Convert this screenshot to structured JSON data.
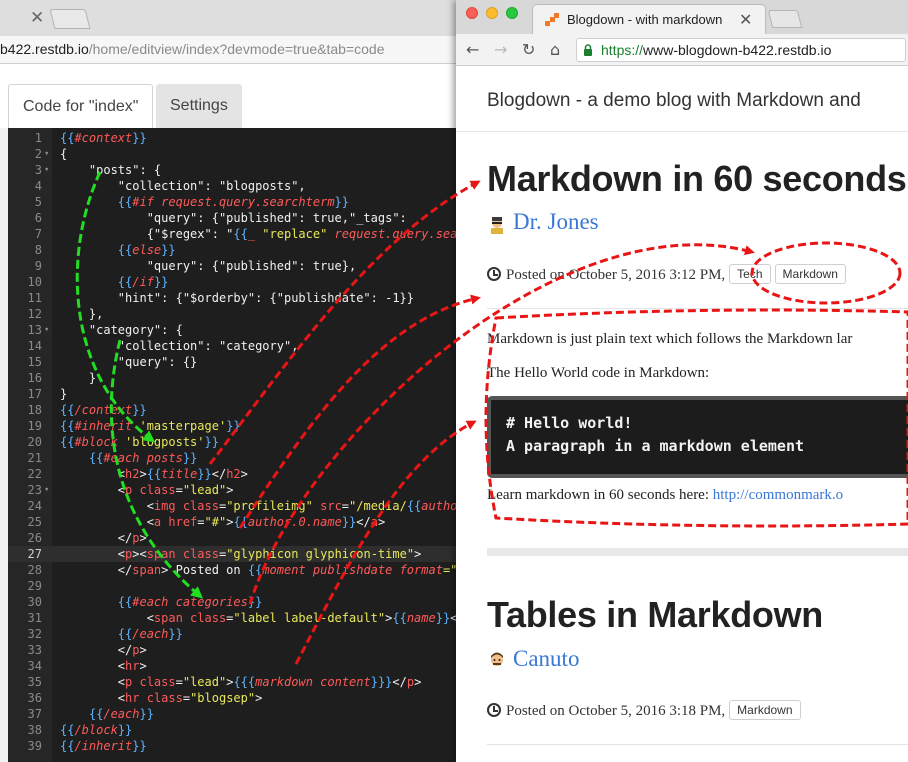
{
  "editor_window": {
    "address_host": "b422.restdb.io",
    "address_path": "/home/editview/index?devmode=true&tab=code",
    "tabs": [
      {
        "label": "Code for \"index\""
      },
      {
        "label": "Settings"
      }
    ],
    "current_line": 27,
    "lines": [
      {
        "n": 1,
        "fold": false,
        "segs": [
          {
            "t": "{{",
            "c": "b"
          },
          {
            "t": "#context",
            "c": "k"
          },
          {
            "t": "}}",
            "c": "b"
          }
        ]
      },
      {
        "n": 2,
        "fold": true,
        "segs": [
          {
            "t": "{",
            "c": "n"
          }
        ]
      },
      {
        "n": 3,
        "fold": true,
        "segs": [
          {
            "t": "    \"posts\": {",
            "c": "n"
          }
        ]
      },
      {
        "n": 4,
        "fold": false,
        "segs": [
          {
            "t": "        \"collection\": \"blogposts\",",
            "c": "n"
          }
        ]
      },
      {
        "n": 5,
        "fold": false,
        "segs": [
          {
            "t": "        ",
            "c": "n"
          },
          {
            "t": "{{",
            "c": "b"
          },
          {
            "t": "#if request.query.searchterm",
            "c": "k"
          },
          {
            "t": "}}",
            "c": "b"
          }
        ]
      },
      {
        "n": 6,
        "fold": false,
        "segs": [
          {
            "t": "            \"query\": {\"published\": true,\"_tags\":",
            "c": "n"
          }
        ]
      },
      {
        "n": 7,
        "fold": false,
        "segs": [
          {
            "t": "            {\"$regex\": \"",
            "c": "n"
          },
          {
            "t": "{{",
            "c": "b"
          },
          {
            "t": "_ ",
            "c": "k"
          },
          {
            "t": "\"replace\"",
            "c": "s"
          },
          {
            "t": " request.query.sea",
            "c": "k"
          }
        ]
      },
      {
        "n": 8,
        "fold": false,
        "segs": [
          {
            "t": "        ",
            "c": "n"
          },
          {
            "t": "{{",
            "c": "b"
          },
          {
            "t": "else",
            "c": "k"
          },
          {
            "t": "}}",
            "c": "b"
          }
        ]
      },
      {
        "n": 9,
        "fold": false,
        "segs": [
          {
            "t": "            \"query\": {\"published\": true},",
            "c": "n"
          }
        ]
      },
      {
        "n": 10,
        "fold": false,
        "segs": [
          {
            "t": "        ",
            "c": "n"
          },
          {
            "t": "{{",
            "c": "b"
          },
          {
            "t": "/if",
            "c": "k"
          },
          {
            "t": "}}",
            "c": "b"
          }
        ]
      },
      {
        "n": 11,
        "fold": false,
        "segs": [
          {
            "t": "        \"hint\": {\"$orderby\": {\"publishdate\": -1}}",
            "c": "n"
          }
        ]
      },
      {
        "n": 12,
        "fold": false,
        "segs": [
          {
            "t": "    },",
            "c": "n"
          }
        ]
      },
      {
        "n": 13,
        "fold": true,
        "segs": [
          {
            "t": "    \"category\": {",
            "c": "n"
          }
        ]
      },
      {
        "n": 14,
        "fold": false,
        "segs": [
          {
            "t": "        \"collection\": \"category\",",
            "c": "n"
          }
        ]
      },
      {
        "n": 15,
        "fold": false,
        "segs": [
          {
            "t": "        \"query\": {}",
            "c": "n"
          }
        ]
      },
      {
        "n": 16,
        "fold": false,
        "segs": [
          {
            "t": "    }",
            "c": "n"
          }
        ]
      },
      {
        "n": 17,
        "fold": false,
        "segs": [
          {
            "t": "}",
            "c": "n"
          }
        ]
      },
      {
        "n": 18,
        "fold": false,
        "segs": [
          {
            "t": "{{",
            "c": "b"
          },
          {
            "t": "/context",
            "c": "k"
          },
          {
            "t": "}}",
            "c": "b"
          }
        ]
      },
      {
        "n": 19,
        "fold": false,
        "segs": [
          {
            "t": "{{",
            "c": "b"
          },
          {
            "t": "#inherit ",
            "c": "k"
          },
          {
            "t": "'masterpage'",
            "c": "s"
          },
          {
            "t": "}}",
            "c": "b"
          }
        ]
      },
      {
        "n": 20,
        "fold": false,
        "segs": [
          {
            "t": "{{",
            "c": "b"
          },
          {
            "t": "#block ",
            "c": "k"
          },
          {
            "t": "'blogposts'",
            "c": "s"
          },
          {
            "t": "}}",
            "c": "b"
          }
        ]
      },
      {
        "n": 21,
        "fold": false,
        "segs": [
          {
            "t": "    ",
            "c": "n"
          },
          {
            "t": "{{",
            "c": "b"
          },
          {
            "t": "#each posts",
            "c": "k"
          },
          {
            "t": "}}",
            "c": "b"
          }
        ]
      },
      {
        "n": 22,
        "fold": false,
        "segs": [
          {
            "t": "        <",
            "c": "n"
          },
          {
            "t": "h2",
            "c": "t"
          },
          {
            "t": ">",
            "c": "n"
          },
          {
            "t": "{{",
            "c": "b"
          },
          {
            "t": "title",
            "c": "k"
          },
          {
            "t": "}}",
            "c": "b"
          },
          {
            "t": "</",
            "c": "n"
          },
          {
            "t": "h2",
            "c": "t"
          },
          {
            "t": ">",
            "c": "n"
          }
        ]
      },
      {
        "n": 23,
        "fold": true,
        "segs": [
          {
            "t": "        <",
            "c": "n"
          },
          {
            "t": "p ",
            "c": "t"
          },
          {
            "t": "class",
            "c": "a"
          },
          {
            "t": "=",
            "c": "n"
          },
          {
            "t": "\"lead\"",
            "c": "s"
          },
          {
            "t": ">",
            "c": "n"
          }
        ]
      },
      {
        "n": 24,
        "fold": false,
        "segs": [
          {
            "t": "            <",
            "c": "n"
          },
          {
            "t": "img ",
            "c": "t"
          },
          {
            "t": "class",
            "c": "a"
          },
          {
            "t": "=",
            "c": "n"
          },
          {
            "t": "\"profileimg\"",
            "c": "s"
          },
          {
            "t": " src",
            "c": "a"
          },
          {
            "t": "=",
            "c": "n"
          },
          {
            "t": "\"/media/",
            "c": "s"
          },
          {
            "t": "{{",
            "c": "b"
          },
          {
            "t": "autho",
            "c": "k"
          }
        ]
      },
      {
        "n": 25,
        "fold": false,
        "segs": [
          {
            "t": "            <",
            "c": "n"
          },
          {
            "t": "a ",
            "c": "t"
          },
          {
            "t": "href",
            "c": "a"
          },
          {
            "t": "=",
            "c": "n"
          },
          {
            "t": "\"#\"",
            "c": "s"
          },
          {
            "t": ">",
            "c": "n"
          },
          {
            "t": "{{",
            "c": "b"
          },
          {
            "t": "author.0.name",
            "c": "k"
          },
          {
            "t": "}}",
            "c": "b"
          },
          {
            "t": "</",
            "c": "n"
          },
          {
            "t": "a",
            "c": "t"
          },
          {
            "t": ">",
            "c": "n"
          }
        ]
      },
      {
        "n": 26,
        "fold": false,
        "segs": [
          {
            "t": "        </",
            "c": "n"
          },
          {
            "t": "p",
            "c": "t"
          },
          {
            "t": ">",
            "c": "n"
          }
        ]
      },
      {
        "n": 27,
        "fold": false,
        "segs": [
          {
            "t": "        <",
            "c": "n"
          },
          {
            "t": "p",
            "c": "t"
          },
          {
            "t": "><",
            "c": "n"
          },
          {
            "t": "span ",
            "c": "t"
          },
          {
            "t": "class",
            "c": "a"
          },
          {
            "t": "=",
            "c": "n"
          },
          {
            "t": "\"glyphicon glyphicon-time\"",
            "c": "s"
          },
          {
            "t": ">",
            "c": "n"
          }
        ]
      },
      {
        "n": 28,
        "fold": false,
        "segs": [
          {
            "t": "        </",
            "c": "n"
          },
          {
            "t": "span",
            "c": "t"
          },
          {
            "t": "> Posted on ",
            "c": "n"
          },
          {
            "t": "{{",
            "c": "b"
          },
          {
            "t": "moment publishdate format",
            "c": "k"
          },
          {
            "t": "=\"",
            "c": "s"
          }
        ]
      },
      {
        "n": 29,
        "fold": false,
        "segs": [
          {
            "t": "",
            "c": "n"
          }
        ]
      },
      {
        "n": 30,
        "fold": false,
        "segs": [
          {
            "t": "        ",
            "c": "n"
          },
          {
            "t": "{{",
            "c": "b"
          },
          {
            "t": "#each categories",
            "c": "k"
          },
          {
            "t": "}}",
            "c": "b"
          }
        ]
      },
      {
        "n": 31,
        "fold": false,
        "segs": [
          {
            "t": "            <",
            "c": "n"
          },
          {
            "t": "span ",
            "c": "t"
          },
          {
            "t": "class",
            "c": "a"
          },
          {
            "t": "=",
            "c": "n"
          },
          {
            "t": "\"label label-default\"",
            "c": "s"
          },
          {
            "t": ">",
            "c": "n"
          },
          {
            "t": "{{",
            "c": "b"
          },
          {
            "t": "name",
            "c": "k"
          },
          {
            "t": "}}",
            "c": "b"
          },
          {
            "t": "<",
            "c": "n"
          }
        ]
      },
      {
        "n": 32,
        "fold": false,
        "segs": [
          {
            "t": "        ",
            "c": "n"
          },
          {
            "t": "{{",
            "c": "b"
          },
          {
            "t": "/each",
            "c": "k"
          },
          {
            "t": "}}",
            "c": "b"
          }
        ]
      },
      {
        "n": 33,
        "fold": false,
        "segs": [
          {
            "t": "        </",
            "c": "n"
          },
          {
            "t": "p",
            "c": "t"
          },
          {
            "t": ">",
            "c": "n"
          }
        ]
      },
      {
        "n": 34,
        "fold": false,
        "segs": [
          {
            "t": "        <",
            "c": "n"
          },
          {
            "t": "hr",
            "c": "t"
          },
          {
            "t": ">",
            "c": "n"
          }
        ]
      },
      {
        "n": 35,
        "fold": false,
        "segs": [
          {
            "t": "        <",
            "c": "n"
          },
          {
            "t": "p ",
            "c": "t"
          },
          {
            "t": "class",
            "c": "a"
          },
          {
            "t": "=",
            "c": "n"
          },
          {
            "t": "\"lead\"",
            "c": "s"
          },
          {
            "t": ">",
            "c": "n"
          },
          {
            "t": "{{{",
            "c": "b"
          },
          {
            "t": "markdown content",
            "c": "k"
          },
          {
            "t": "}}}",
            "c": "b"
          },
          {
            "t": "</",
            "c": "n"
          },
          {
            "t": "p",
            "c": "t"
          },
          {
            "t": ">",
            "c": "n"
          }
        ]
      },
      {
        "n": 36,
        "fold": false,
        "segs": [
          {
            "t": "        <",
            "c": "n"
          },
          {
            "t": "hr ",
            "c": "t"
          },
          {
            "t": "class",
            "c": "a"
          },
          {
            "t": "=",
            "c": "n"
          },
          {
            "t": "\"blogsep\"",
            "c": "s"
          },
          {
            "t": ">",
            "c": "n"
          }
        ]
      },
      {
        "n": 37,
        "fold": false,
        "segs": [
          {
            "t": "    ",
            "c": "n"
          },
          {
            "t": "{{",
            "c": "b"
          },
          {
            "t": "/each",
            "c": "k"
          },
          {
            "t": "}}",
            "c": "b"
          }
        ]
      },
      {
        "n": 38,
        "fold": false,
        "segs": [
          {
            "t": "{{",
            "c": "b"
          },
          {
            "t": "/block",
            "c": "k"
          },
          {
            "t": "}}",
            "c": "b"
          }
        ]
      },
      {
        "n": 39,
        "fold": false,
        "segs": [
          {
            "t": "{{",
            "c": "b"
          },
          {
            "t": "/inherit",
            "c": "k"
          },
          {
            "t": "}}",
            "c": "b"
          }
        ]
      }
    ],
    "syntax_colors": {
      "b": "#60b4ff",
      "k": "#ff5a5a",
      "s": "#e8e85a",
      "t": "#ff5a5a",
      "a": "#ff5a5a",
      "n": "#f0f0f0"
    }
  },
  "browser_window": {
    "tab_title": "Blogdown - with markdown",
    "url_scheme": "https://",
    "url_host": "www-blogdown-b422.restdb.io",
    "site_title": "Blogdown - a demo blog with Markdown and",
    "posts": [
      {
        "title": "Markdown in 60 seconds",
        "author": "Dr. Jones",
        "posted": "Posted on October 5, 2016 3:12 PM,",
        "categories": [
          "Tech",
          "Markdown"
        ],
        "intro": "Markdown is just plain text which follows the Markdown lar",
        "hello_label": "The Hello World code in Markdown:",
        "code_lines": [
          "# Hello world!",
          "A paragraph in a markdown element"
        ],
        "learn_text": "Learn markdown in 60 seconds here:",
        "learn_link": "http://commonmark.o"
      },
      {
        "title": "Tables in Markdown",
        "author": "Canuto",
        "posted": "Posted on October 5, 2016 3:18 PM,",
        "categories": [
          "Markdown"
        ]
      }
    ]
  },
  "annotation_colors": {
    "red": "#e81515",
    "green": "#22dd22"
  }
}
